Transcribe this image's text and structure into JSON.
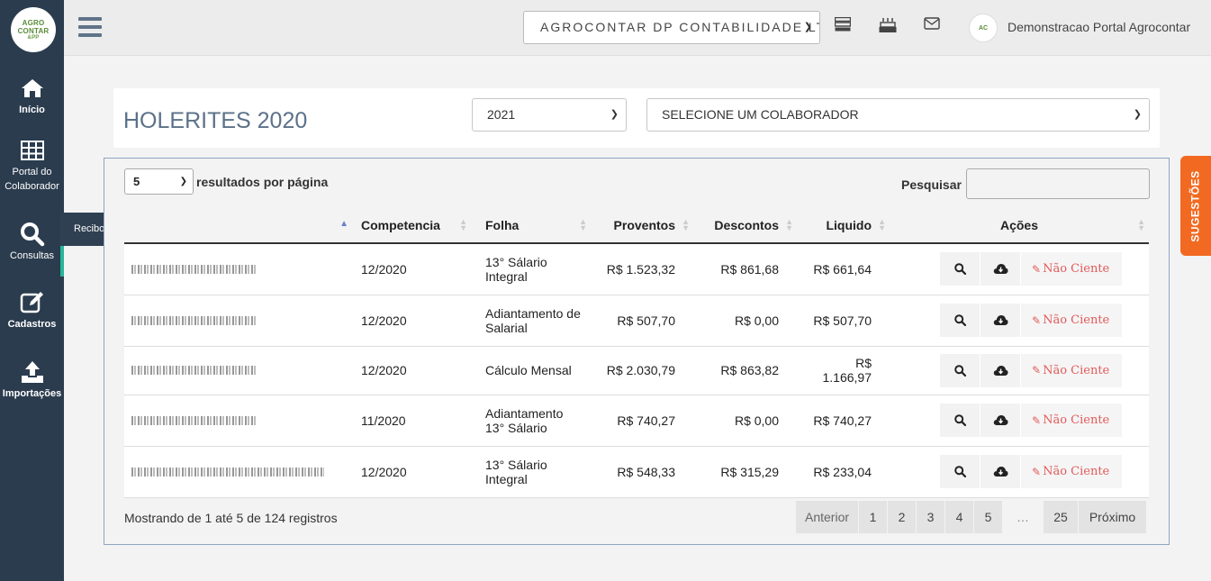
{
  "app": {
    "logo_lines": [
      "AGRO",
      "CONTAR"
    ],
    "logo_suffix": "&PP"
  },
  "sidebar": {
    "items": [
      {
        "label": "Início",
        "icon": "home-icon"
      },
      {
        "label": "Portal do Colaborador",
        "icon": "grid-icon"
      },
      {
        "label": "Consultas",
        "icon": "search-icon"
      },
      {
        "label": "Cadastros",
        "icon": "edit-icon"
      },
      {
        "label": "Importações",
        "icon": "upload-icon"
      }
    ],
    "submenu_item": "Recibos de Pagamento"
  },
  "topbar": {
    "company_value": "AGROCONTAR DP CONTABILIDADE LT",
    "user_name": "Demonstracao Portal Agrocontar"
  },
  "header": {
    "title": "HOLERITES 2020",
    "year_value": "2021",
    "collaborator_value": "SELECIONE UM COLABORADOR"
  },
  "table_controls": {
    "per_page_value": "5",
    "per_page_label": "resultados por página",
    "search_label": "Pesquisar"
  },
  "table": {
    "headers": [
      "",
      "Competencia",
      "Folha",
      "Proventos",
      "Descontos",
      "Liquido",
      "Ações"
    ],
    "rows": [
      {
        "competencia": "12/2020",
        "folha": "13° Sálario Integral",
        "proventos": "R$ 1.523,32",
        "descontos": "R$ 861,68",
        "liquido": "R$ 661,64",
        "status": "Não Ciente"
      },
      {
        "competencia": "12/2020",
        "folha": "Adiantamento de Salarial",
        "proventos": "R$ 507,70",
        "descontos": "R$ 0,00",
        "liquido": "R$ 507,70",
        "status": "Não Ciente"
      },
      {
        "competencia": "12/2020",
        "folha": "Cálculo Mensal",
        "proventos": "R$ 2.030,79",
        "descontos": "R$ 863,82",
        "liquido": "R$ 1.166,97",
        "status": "Não Ciente"
      },
      {
        "competencia": "11/2020",
        "folha": "Adiantamento 13° Sálario",
        "proventos": "R$ 740,27",
        "descontos": "R$ 0,00",
        "liquido": "R$ 740,27",
        "status": "Não Ciente"
      },
      {
        "competencia": "12/2020",
        "folha": "13° Sálario Integral",
        "proventos": "R$ 548,33",
        "descontos": "R$ 315,29",
        "liquido": "R$ 233,04",
        "status": "Não Ciente"
      }
    ]
  },
  "footer": {
    "info": "Mostrando de 1 até 5 de 124 registros",
    "prev": "Anterior",
    "pages": [
      "1",
      "2",
      "3",
      "4",
      "5"
    ],
    "ellipsis": "…",
    "last": "25",
    "next": "Próximo"
  },
  "sugestoes": "SUGESTÕES",
  "colors": {
    "sidebar": "#2b3c4e",
    "accent": "#27b59a",
    "title": "#5b7189",
    "danger": "#e25a5a",
    "orange": "#f26a21"
  }
}
